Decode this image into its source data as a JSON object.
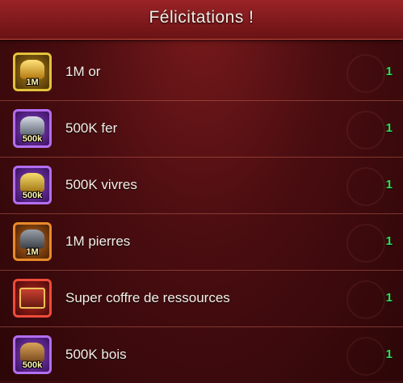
{
  "dialog": {
    "title": "Félicitations !"
  },
  "rewards": [
    {
      "name": "1M or",
      "badge": "1M",
      "quantity": "1",
      "icon": "gold-pile-icon",
      "frame_color": "#e3c23a"
    },
    {
      "name": "500K fer",
      "badge": "500k",
      "quantity": "1",
      "icon": "iron-pile-icon",
      "frame_color": "#b36ef0"
    },
    {
      "name": "500K vivres",
      "badge": "500k",
      "quantity": "1",
      "icon": "food-pile-icon",
      "frame_color": "#b36ef0"
    },
    {
      "name": "1M pierres",
      "badge": "1M",
      "quantity": "1",
      "icon": "stone-pile-icon",
      "frame_color": "#e88a2a"
    },
    {
      "name": "Super coffre de ressources",
      "badge": "",
      "quantity": "1",
      "icon": "resource-chest-icon",
      "frame_color": "#ee4b3a"
    },
    {
      "name": "500K bois",
      "badge": "500k",
      "quantity": "1",
      "icon": "wood-pile-icon",
      "frame_color": "#b36ef0"
    }
  ],
  "colors": {
    "quantity": "#2fe05a",
    "header": "#9a2326",
    "background": "#4a0d10"
  }
}
